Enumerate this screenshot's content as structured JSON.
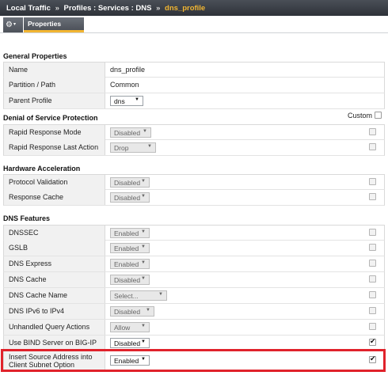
{
  "breadcrumb": {
    "root": "Local Traffic",
    "sep": "»",
    "middle": "Profiles : Services : DNS",
    "current": "dns_profile"
  },
  "tabs": {
    "gear_caret": "▾",
    "active": "Properties"
  },
  "general": {
    "heading": "General Properties",
    "rows": [
      {
        "label": "Name",
        "value": "dns_profile"
      },
      {
        "label": "Partition / Path",
        "value": "Common"
      },
      {
        "label": "Parent Profile",
        "value": "dns"
      }
    ]
  },
  "dos": {
    "heading": "Denial of Service Protection",
    "custom_label": "Custom",
    "rows": [
      {
        "label": "Rapid Response Mode",
        "value": "Disabled",
        "checked": false
      },
      {
        "label": "Rapid Response Last Action",
        "value": "Drop",
        "checked": false
      }
    ]
  },
  "hw": {
    "heading": "Hardware Acceleration",
    "rows": [
      {
        "label": "Protocol Validation",
        "value": "Disabled",
        "checked": false
      },
      {
        "label": "Response Cache",
        "value": "Disabled",
        "checked": false
      }
    ]
  },
  "dns": {
    "heading": "DNS Features",
    "rows": [
      {
        "label": "DNSSEC",
        "value": "Enabled",
        "checked": false
      },
      {
        "label": "GSLB",
        "value": "Enabled",
        "checked": false
      },
      {
        "label": "DNS Express",
        "value": "Enabled",
        "checked": false
      },
      {
        "label": "DNS Cache",
        "value": "Disabled",
        "checked": false
      },
      {
        "label": "DNS Cache Name",
        "value": "Select...",
        "checked": false
      },
      {
        "label": "DNS IPv6 to IPv4",
        "value": "Disabled",
        "checked": false
      },
      {
        "label": "Unhandled Query Actions",
        "value": "Allow",
        "checked": false
      },
      {
        "label": "Use BIND Server on BIG-IP",
        "value": "Disabled",
        "checked": true
      },
      {
        "label_line1": "Insert Source Address into",
        "label_line2": "Client Subnet Option",
        "value": "Enabled",
        "checked": true
      }
    ]
  },
  "colors": {
    "highlight": "#e0222b",
    "accent": "#f2b632",
    "header_bg": "#3a3f46"
  }
}
